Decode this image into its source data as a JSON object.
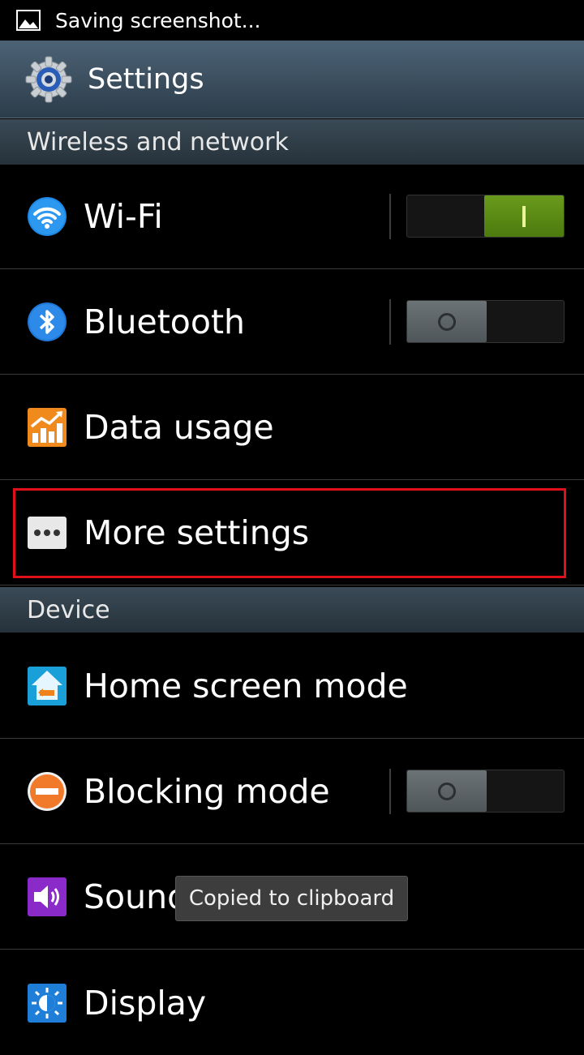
{
  "status_bar": {
    "text": "Saving screenshot..."
  },
  "action_bar": {
    "title": "Settings"
  },
  "sections": {
    "wireless": "Wireless and network",
    "device": "Device"
  },
  "items": {
    "wifi": {
      "label": "Wi-Fi",
      "toggle": "on"
    },
    "bluetooth": {
      "label": "Bluetooth",
      "toggle": "off"
    },
    "data_usage": {
      "label": "Data usage"
    },
    "more_settings": {
      "label": "More settings"
    },
    "home_screen": {
      "label": "Home screen mode"
    },
    "blocking": {
      "label": "Blocking mode",
      "toggle": "off"
    },
    "sound": {
      "label": "Sound"
    },
    "display": {
      "label": "Display"
    }
  },
  "toast": {
    "text": "Copied to clipboard"
  },
  "colors": {
    "highlight": "#e0101a",
    "toggle_on": "#5a8a16",
    "toggle_off": "#5d6569"
  }
}
